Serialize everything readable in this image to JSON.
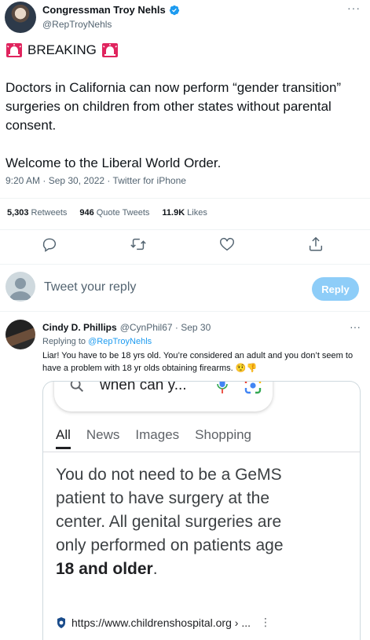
{
  "author": {
    "name": "Congressman Troy Nehls",
    "handle": "@RepTroyNehls"
  },
  "tweet": {
    "breaking": "BREAKING",
    "body": "Doctors in California can now perform “gender transition” surgeries on children from other states without parental consent.",
    "closing": "Welcome to the Liberal World Order."
  },
  "meta": {
    "timestamp": "9:20 AM · Sep 30, 2022 · Twitter for iPhone"
  },
  "stats": {
    "retweets_count": "5,303",
    "retweets_label": "Retweets",
    "quotes_count": "946",
    "quotes_label": "Quote Tweets",
    "likes_count": "11.9K",
    "likes_label": "Likes"
  },
  "reply_composer": {
    "placeholder": "Tweet your reply",
    "button_label": "Reply"
  },
  "reply": {
    "name": "Cindy D. Phillips",
    "handle_time": "@CynPhil67 · Sep 30",
    "replying_label": "Replying to",
    "replying_to": "@RepTroyNehls",
    "text": "Liar! You have to be 18 yrs old. You’re considered an adult and you don’t seem to have a problem with 18 yr olds obtaining firearms. 🤨👎"
  },
  "media": {
    "search_query": "when can y...",
    "tabs": [
      "All",
      "News",
      "Images",
      "Shopping"
    ],
    "snippet_plain": "You do not need to be a GeMS patient to have surgery at the center. All genital surgeries are only performed on patients age",
    "snippet_bold": "18 and older",
    "snippet_end": ".",
    "url": "https://www.childrenshospital.org › ..."
  },
  "colors": {
    "accent": "#1d9bf0",
    "reply_button": "#8ecdf8",
    "siren": "#e0245e"
  }
}
